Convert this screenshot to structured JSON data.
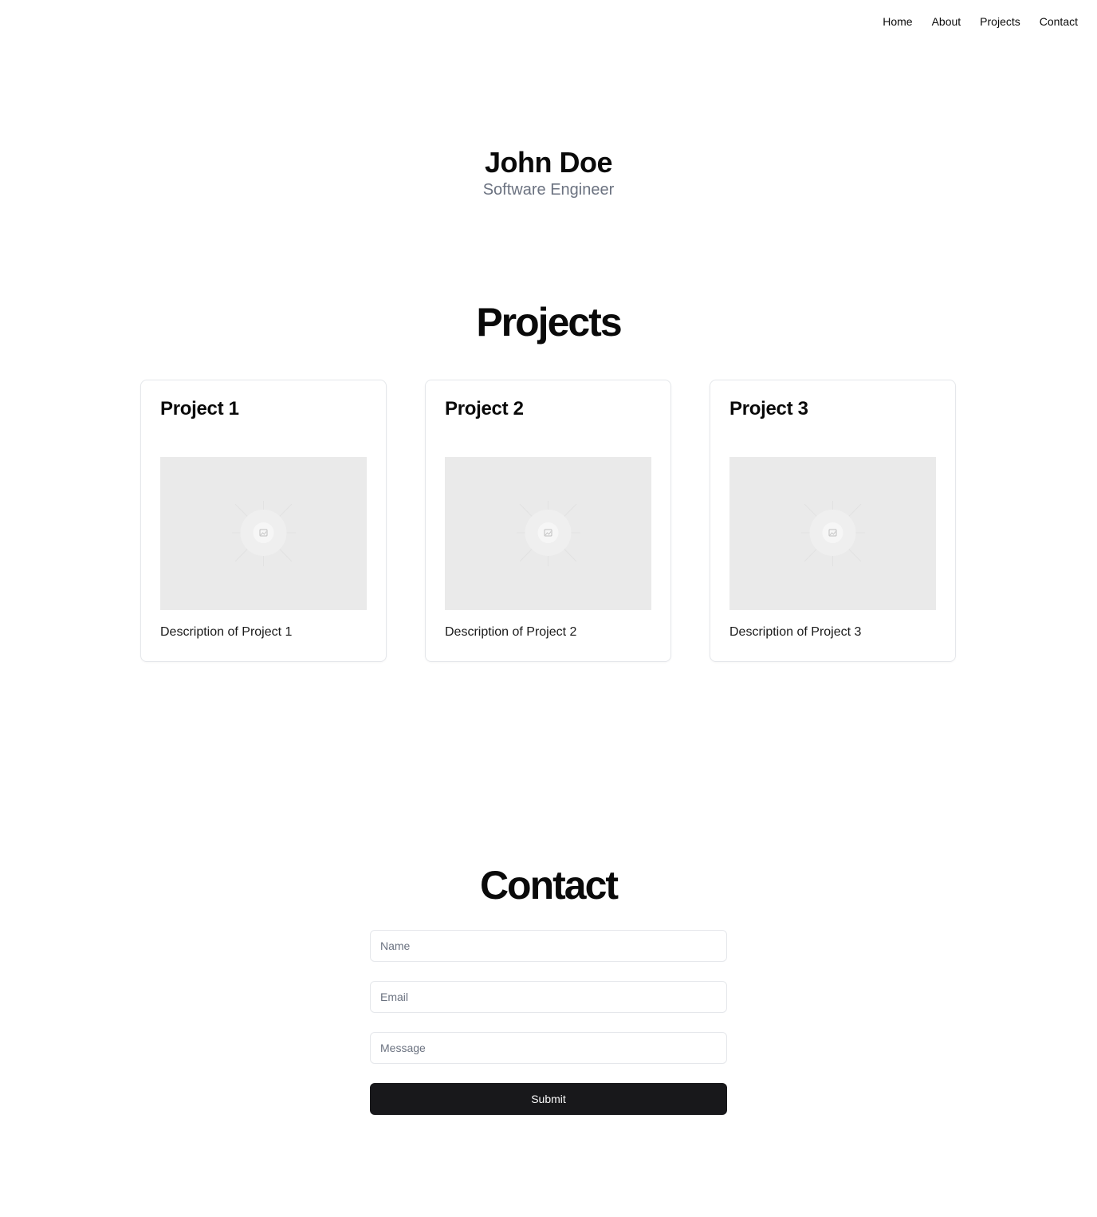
{
  "nav": {
    "items": [
      {
        "label": "Home"
      },
      {
        "label": "About"
      },
      {
        "label": "Projects"
      },
      {
        "label": "Contact"
      }
    ]
  },
  "hero": {
    "name": "John Doe",
    "role": "Software Engineer"
  },
  "projects": {
    "title": "Projects",
    "items": [
      {
        "title": "Project 1",
        "image": "image-placeholder-icon",
        "description": "Description of Project 1"
      },
      {
        "title": "Project 2",
        "image": "image-placeholder-icon",
        "description": "Description of Project 2"
      },
      {
        "title": "Project 3",
        "image": "image-placeholder-icon",
        "description": "Description of Project 3"
      }
    ]
  },
  "contact": {
    "title": "Contact",
    "fields": [
      {
        "placeholder": "Name",
        "value": ""
      },
      {
        "placeholder": "Email",
        "value": ""
      },
      {
        "placeholder": "Message",
        "value": ""
      }
    ],
    "submit_label": "Submit"
  },
  "colors": {
    "background": "#ffffff",
    "text": "#0a0a0a",
    "muted_text": "#6b7280",
    "border": "#e5e7eb",
    "placeholder_bg": "#eaeaea",
    "button_bg": "#18181b",
    "button_text": "#fafafa"
  }
}
